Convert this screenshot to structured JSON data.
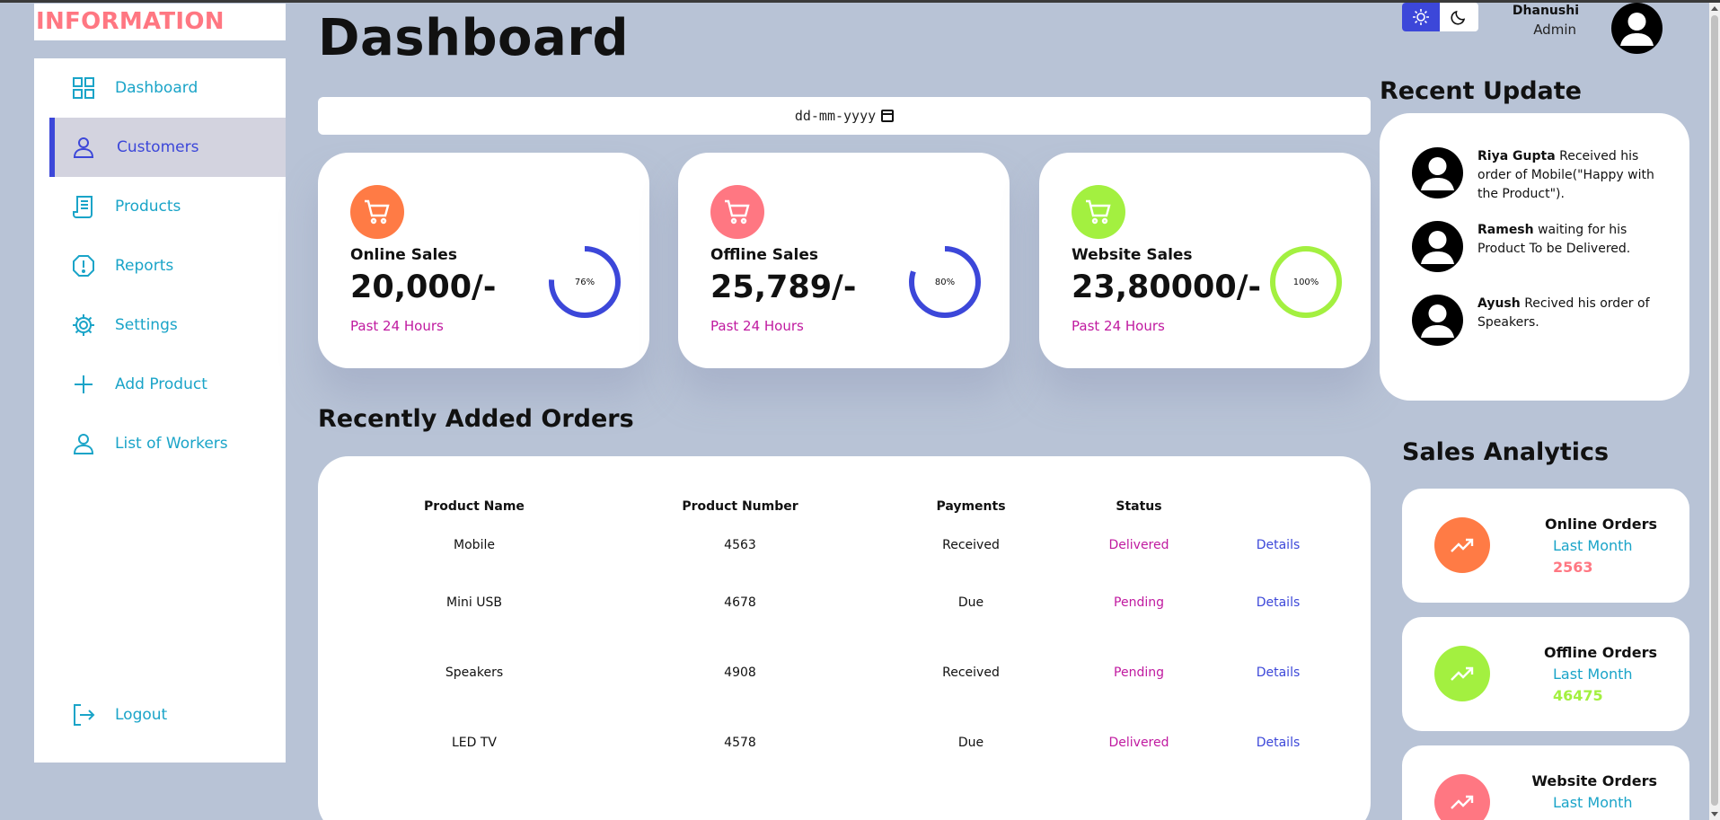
{
  "brand": "INFORMATION",
  "sidebar": {
    "items": [
      {
        "label": "Dashboard",
        "icon": "grid-icon"
      },
      {
        "label": "Customers",
        "icon": "person-icon",
        "active": true
      },
      {
        "label": "Products",
        "icon": "receipt-icon"
      },
      {
        "label": "Reports",
        "icon": "alert-icon"
      },
      {
        "label": "Settings",
        "icon": "gear-icon"
      },
      {
        "label": "Add Product",
        "icon": "plus-icon"
      },
      {
        "label": "List of Workers",
        "icon": "person-icon"
      }
    ],
    "logout": "Logout"
  },
  "header": {
    "title": "Dashboard",
    "date_placeholder": "dd-mm-yyyy",
    "user_name": "Dhanushi",
    "user_role": "Admin"
  },
  "cards": [
    {
      "title": "Online Sales",
      "value": "20,000/-",
      "sub": "Past 24 Hours",
      "percent_label": "76%",
      "percent": 76,
      "color": "#ff7b45",
      "ring": "#3c47d9"
    },
    {
      "title": "Offline Sales",
      "value": "25,789/-",
      "sub": "Past 24 Hours",
      "percent_label": "80%",
      "percent": 80,
      "color": "#ff7782",
      "ring": "#3c47d9"
    },
    {
      "title": "Website Sales",
      "value": "23,80000/-",
      "sub": "Past 24 Hours",
      "percent_label": "100%",
      "percent": 100,
      "color": "#a3f040",
      "ring": "#a3f040"
    }
  ],
  "orders": {
    "title": "Recently Added Orders",
    "headers": [
      "Product Name",
      "Product Number",
      "Payments",
      "Status",
      ""
    ],
    "rows": [
      {
        "name": "Mobile",
        "number": "4563",
        "payment": "Received",
        "status": "Delivered",
        "action": "Details"
      },
      {
        "name": "Mini USB",
        "number": "4678",
        "payment": "Due",
        "status": "Pending",
        "action": "Details"
      },
      {
        "name": "Speakers",
        "number": "4908",
        "payment": "Received",
        "status": "Pending",
        "action": "Details"
      },
      {
        "name": "LED TV",
        "number": "4578",
        "payment": "Due",
        "status": "Delivered",
        "action": "Details"
      }
    ]
  },
  "updates": {
    "title": "Recent Update",
    "items": [
      {
        "name": "Riya Gupta",
        "text": "Received his order of Mobile(\"Happy with the Product\")."
      },
      {
        "name": "Ramesh",
        "text": "waiting for his Product To be Delivered."
      },
      {
        "name": "Ayush",
        "text": "Recived his order of Speakers."
      }
    ]
  },
  "analytics": {
    "title": "Sales Analytics",
    "items": [
      {
        "title": "Online Orders",
        "period": "Last Month",
        "value": "2563",
        "color": "#ff7b45",
        "value_color": "#ff7782"
      },
      {
        "title": "Offline Orders",
        "period": "Last Month",
        "value": "46475",
        "color": "#a3f040",
        "value_color": "#a3f040"
      },
      {
        "title": "Website Orders",
        "period": "Last Month",
        "value": "",
        "color": "#ff7782",
        "value_color": "#ff7782"
      }
    ]
  }
}
